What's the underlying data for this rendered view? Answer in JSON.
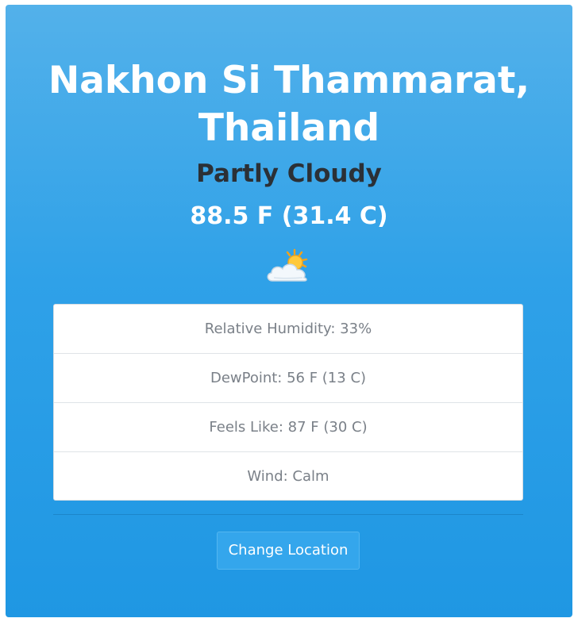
{
  "location": {
    "city_line1": "Nakhon Si Thammarat,",
    "city_line2": "Thailand"
  },
  "current": {
    "condition": "Partly Cloudy",
    "temperature": "88.5 F (31.4 C)",
    "icon": "partly-cloudy-icon"
  },
  "details": [
    {
      "label": "Relative Humidity: 33%"
    },
    {
      "label": "DewPoint: 56 F (13 C)"
    },
    {
      "label": "Feels Like: 87 F (30 C)"
    },
    {
      "label": "Wind: Calm"
    }
  ],
  "actions": {
    "change_location_label": "Change Location"
  },
  "colors": {
    "background_top": "#53b1ea",
    "background_bottom": "#1f97e3",
    "button": "#34a6ec",
    "condition_text": "#2b3036",
    "detail_text": "#7a8088"
  }
}
